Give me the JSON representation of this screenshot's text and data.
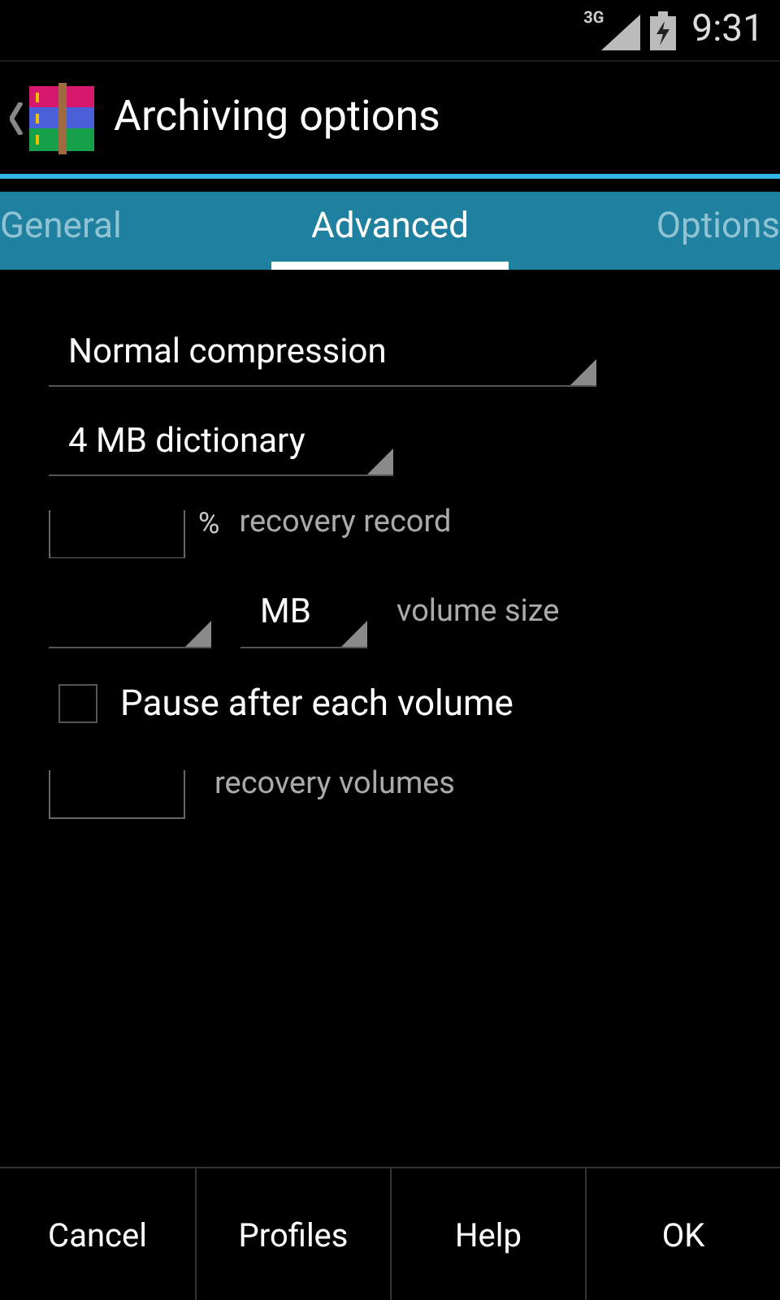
{
  "status_bar": {
    "network": "3G",
    "time": "9:31"
  },
  "action_bar": {
    "title": "Archiving options"
  },
  "tabs": [
    {
      "label": "General",
      "selected": false
    },
    {
      "label": "Advanced",
      "selected": true
    },
    {
      "label": "Options",
      "selected": false
    }
  ],
  "form": {
    "compression": {
      "value": "Normal compression"
    },
    "dictionary": {
      "value": "4 MB dictionary"
    },
    "recovery_record": {
      "unit": "%",
      "label": "recovery record"
    },
    "volume_size": {
      "unit": "MB",
      "label": "volume size"
    },
    "pause": {
      "label": "Pause after each volume",
      "checked": false
    },
    "recovery_volumes": {
      "label": "recovery volumes"
    }
  },
  "buttons": [
    "Cancel",
    "Profiles",
    "Help",
    "OK"
  ]
}
